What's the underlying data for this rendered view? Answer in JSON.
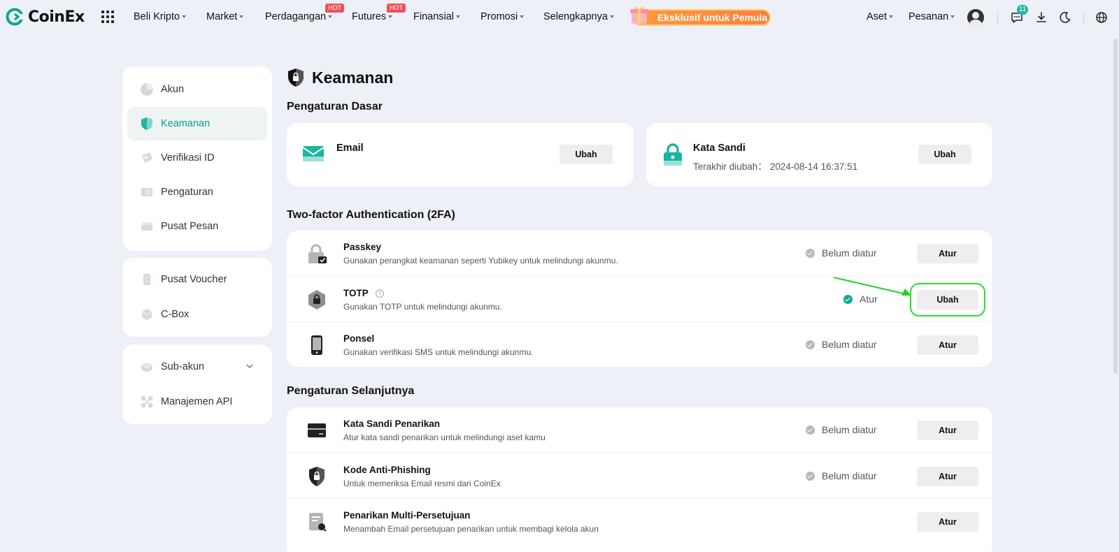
{
  "brand": {
    "name": "CoinEx",
    "accent": "#0d9b8a"
  },
  "nav": {
    "items": [
      {
        "label": "Beli Kripto",
        "hot": ""
      },
      {
        "label": "Market",
        "hot": ""
      },
      {
        "label": "Perdagangan",
        "hot": "HOT"
      },
      {
        "label": "Futures",
        "hot": "HOT"
      },
      {
        "label": "Finansial",
        "hot": ""
      },
      {
        "label": "Promosi",
        "hot": ""
      },
      {
        "label": "Selengkapnya",
        "hot": ""
      }
    ],
    "promo": "Eksklusif untuk Pemula",
    "assets": "Aset",
    "orders": "Pesanan",
    "message_count": "11"
  },
  "sidebar": {
    "group1": [
      {
        "label": "Akun",
        "icon": "user-icon"
      },
      {
        "label": "Keamanan",
        "icon": "shield-icon"
      },
      {
        "label": "Verifikasi ID",
        "icon": "id-card-icon"
      },
      {
        "label": "Pengaturan",
        "icon": "settings-icon"
      },
      {
        "label": "Pusat Pesan",
        "icon": "message-icon"
      }
    ],
    "group2": [
      {
        "label": "Pusat Voucher",
        "icon": "voucher-icon"
      },
      {
        "label": "C-Box",
        "icon": "box-icon"
      }
    ],
    "group3": [
      {
        "label": "Sub-akun",
        "icon": "sub-account-icon"
      },
      {
        "label": "Manajemen API",
        "icon": "api-icon"
      }
    ]
  },
  "page": {
    "title": "Keamanan"
  },
  "basic": {
    "title": "Pengaturan Dasar",
    "email": {
      "label": "Email",
      "button": "Ubah"
    },
    "password": {
      "label": "Kata Sandi",
      "last_changed_label": "Terakhir diubah：",
      "last_changed": "2024-08-14 16:37:51",
      "button": "Ubah"
    }
  },
  "twofa": {
    "title": "Two-factor Authentication (2FA)",
    "rows": [
      {
        "title": "Passkey",
        "desc": "Gunakan perangkat keamanan seperti Yubikey untuk melindungi akunmu.",
        "status": "Belum diatur",
        "button": "Atur"
      },
      {
        "title": "TOTP",
        "desc": "Gunakan TOTP untuk melindungi akunmu.",
        "status": "Atur",
        "button": "Ubah"
      },
      {
        "title": "Ponsel",
        "desc": "Gunakan verifikasi SMS untuk melindungi akunmu.",
        "status": "Belum diatur",
        "button": "Atur"
      }
    ]
  },
  "advanced": {
    "title": "Pengaturan Selanjutnya",
    "rows": [
      {
        "title": "Kata Sandi Penarikan",
        "desc": "Atur kata sandi penarikan untuk melindungi aset kamu",
        "status": "Belum diatur",
        "button": "Atur"
      },
      {
        "title": "Kode Anti-Phishing",
        "desc": "Untuk memeriksa Email resmi dari CoinEx",
        "status": "Belum diatur",
        "button": "Atur"
      },
      {
        "title": "Penarikan Multi-Persetujuan",
        "desc": "Menambah Email persetujuan penarikan untuk membagi kelola akun",
        "status": "",
        "button": "Atur"
      }
    ]
  }
}
